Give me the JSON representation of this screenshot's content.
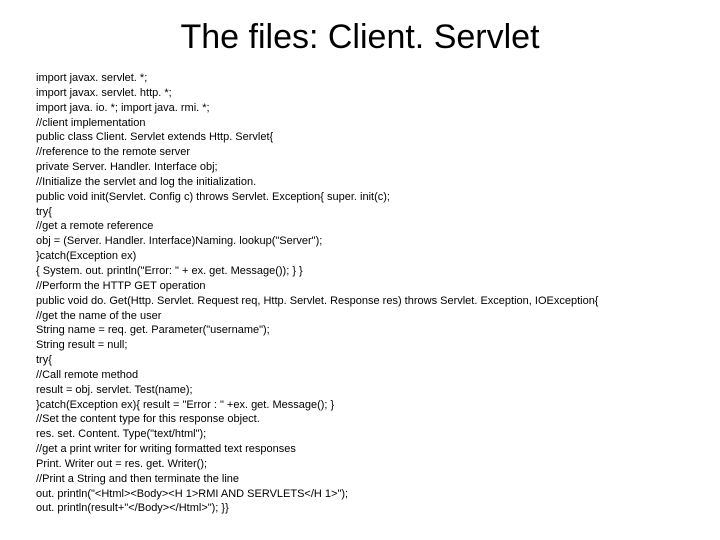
{
  "title": "The files: Client. Servlet",
  "code_lines": [
    "import javax. servlet. *;",
    "import javax. servlet. http. *;",
    "import java. io. *; import java. rmi. *;",
    "//client implementation",
    "public class Client. Servlet extends Http. Servlet{",
    "//reference to the remote server",
    "private Server. Handler. Interface obj;",
    "//Initialize the servlet and log the initialization.",
    "public void init(Servlet. Config c) throws Servlet. Exception{ super. init(c);",
    "try{",
    "//get a remote reference",
    "obj = (Server. Handler. Interface)Naming. lookup(\"Server\");",
    "}catch(Exception ex)",
    "{ System. out. println(\"Error: \" + ex. get. Message()); } }",
    "//Perform the HTTP GET operation",
    "public void do. Get(Http. Servlet. Request req, Http. Servlet. Response res) throws Servlet. Exception, IOException{",
    "//get the name of the user",
    "String name = req. get. Parameter(\"username\");",
    "String result = null;",
    "try{",
    "//Call remote method",
    "result = obj. servlet. Test(name);",
    "}catch(Exception ex){ result = \"Error : \" +ex. get. Message(); }",
    "//Set the content type for this response object.",
    "res. set. Content. Type(\"text/html\");",
    "//get a print writer for writing formatted text responses",
    "Print. Writer out = res. get. Writer();",
    "//Print a String and then terminate the line",
    "out. println(\"<Html><Body><H 1>RMI AND SERVLETS</H 1>\");",
    "out. println(result+\"</Body></Html>\"); }}"
  ]
}
